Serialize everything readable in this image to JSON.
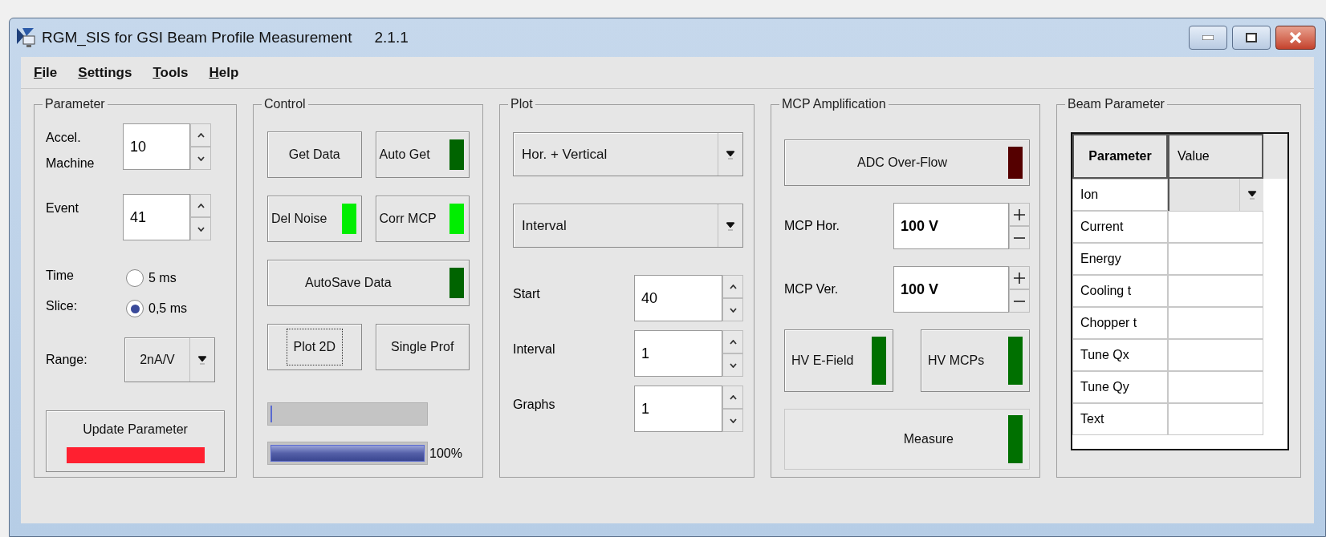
{
  "window": {
    "title": "RGM_SIS for GSI Beam Profile Measurement",
    "version": "2.1.1"
  },
  "menu": [
    {
      "label": "File"
    },
    {
      "label": "Settings"
    },
    {
      "label": "Tools"
    },
    {
      "label": "Help"
    }
  ],
  "parameter": {
    "title": "Parameter",
    "spinners": [
      {
        "label": "Accel. Machine",
        "value": "10"
      },
      {
        "label": "Event",
        "value": "41"
      }
    ],
    "time_slice": {
      "label": "Time Slice:",
      "options": [
        {
          "label": "5 ms",
          "selected": false
        },
        {
          "label": "0,5 ms",
          "selected": true
        }
      ]
    },
    "range": {
      "label": "Range:",
      "value": "2nA/V"
    },
    "update_button": {
      "label": "Update Parameter",
      "color": "#ff2030"
    }
  },
  "control": {
    "title": "Control",
    "buttons": [
      {
        "label": "Get Data",
        "kind": "plain",
        "focused": false
      },
      {
        "label": "Auto Get",
        "kind": "indicator",
        "color": "#006400"
      },
      {
        "label": "Del Noise",
        "kind": "indicator",
        "color": "#00ee00"
      },
      {
        "label": "Corr MCP",
        "kind": "indicator",
        "color": "#00ee00"
      },
      {
        "label": "AutoSave Data",
        "kind": "wide",
        "color": "#006400"
      },
      {
        "label": "Plot 2D",
        "kind": "plain",
        "focused": true
      },
      {
        "label": "Single Prof",
        "kind": "plain",
        "focused": false
      }
    ],
    "progress": [
      {
        "level": 0.01
      },
      {
        "level": 1,
        "reading": "100%"
      }
    ]
  },
  "plot": {
    "title": "Plot",
    "dropdowns": [
      {
        "value": "Hor. + Vertical"
      },
      {
        "value": "Interval"
      }
    ],
    "spinners": [
      {
        "label": "Start",
        "value": "40"
      },
      {
        "label": "Interval",
        "value": "1"
      },
      {
        "label": "Graphs",
        "value": "1"
      }
    ]
  },
  "mcp": {
    "title": "MCP Amplification",
    "overflow": {
      "label": "ADC Over-Flow",
      "color": "#550000"
    },
    "voltages": [
      {
        "label": "MCP Hor.",
        "value": "100 V"
      },
      {
        "label": "MCP Ver.",
        "value": "100 V"
      }
    ],
    "hv_buttons": [
      {
        "label": "HV E-Field",
        "color": "#007000"
      },
      {
        "label": "HV MCPs",
        "color": "#007000"
      }
    ],
    "measure": {
      "label": "Measure",
      "color": "#007000"
    }
  },
  "beam": {
    "title": "Beam Parameter",
    "columns": [
      {
        "label": "Parameter",
        "selected": true
      },
      {
        "label": "Value",
        "selected": false
      }
    ],
    "rows": [
      {
        "name": "Ion",
        "kind": "combo"
      },
      {
        "name": "Current",
        "kind": "text"
      },
      {
        "name": "Energy",
        "kind": "text"
      },
      {
        "name": "Cooling t",
        "kind": "text"
      },
      {
        "name": "Chopper t",
        "kind": "text"
      },
      {
        "name": "Tune Qx",
        "kind": "text"
      },
      {
        "name": "Tune Qy",
        "kind": "text"
      },
      {
        "name": "Text",
        "kind": "text"
      }
    ]
  }
}
